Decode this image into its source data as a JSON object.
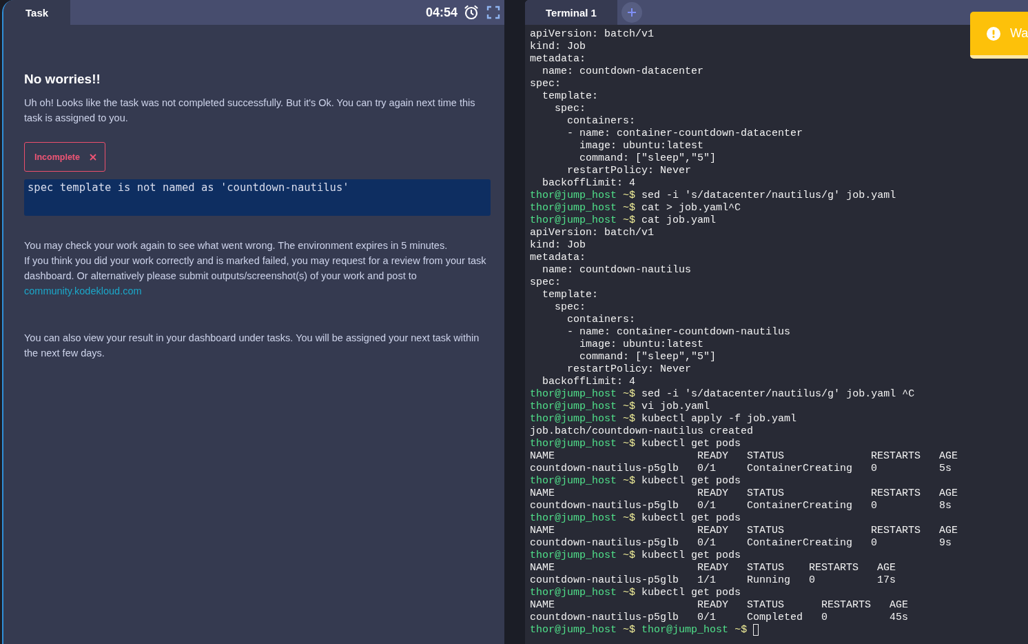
{
  "task_panel": {
    "tab": {
      "label": "Task",
      "selected": true
    },
    "timer": "04:54",
    "heading": "No worries!!",
    "intro": "Uh oh! Looks like the task was not completed successfully. But it's Ok. You can try again next time this task is assigned to you.",
    "status_badge": "Incomplete",
    "error_message": "spec template is not named as 'countdown-nautilus'",
    "notice": {
      "lines": [
        "You may check your work again to see what went wrong. The environment expires in 5 minutes.",
        "If you think you did your work correctly and is marked failed, you may request for a review from your task dashboard. Or alternatively please submit outputs/screenshot(s) of your work and post to"
      ],
      "link": "community.kodekloud.com"
    },
    "footer": "You can also view your result in your dashboard under tasks. You will be assigned your next task within the next few days."
  },
  "terminal_panel": {
    "tabs": [
      {
        "label": "Terminal 1",
        "selected": true
      }
    ],
    "toast": {
      "text": "Wa"
    },
    "lines": [
      {
        "kind": "output",
        "text": "apiVersion: batch/v1"
      },
      {
        "kind": "output",
        "text": "kind: Job"
      },
      {
        "kind": "output",
        "text": "metadata:"
      },
      {
        "kind": "output",
        "text": "  name: countdown-datacenter"
      },
      {
        "kind": "output",
        "text": "spec:"
      },
      {
        "kind": "output",
        "text": "  template:"
      },
      {
        "kind": "output",
        "text": "    spec:"
      },
      {
        "kind": "output",
        "text": "      containers:"
      },
      {
        "kind": "output",
        "text": "      - name: container-countdown-datacenter"
      },
      {
        "kind": "output",
        "text": "        image: ubuntu:latest"
      },
      {
        "kind": "output",
        "text": "        command: [\"sleep\",\"5\"]"
      },
      {
        "kind": "output",
        "text": "      restartPolicy: Never"
      },
      {
        "kind": "output",
        "text": "  backoffLimit: 4"
      },
      {
        "kind": "prompt",
        "prompts": [
          {
            "user": "thor@jump_host",
            "path": "~$"
          }
        ],
        "command": "sed -i 's/datacenter/nautilus/g' job.yaml"
      },
      {
        "kind": "prompt",
        "prompts": [
          {
            "user": "thor@jump_host",
            "path": "~$"
          }
        ],
        "command": "cat > job.yaml^C"
      },
      {
        "kind": "prompt",
        "prompts": [
          {
            "user": "thor@jump_host",
            "path": "~$"
          }
        ],
        "command": "cat job.yaml"
      },
      {
        "kind": "output",
        "text": "apiVersion: batch/v1"
      },
      {
        "kind": "output",
        "text": "kind: Job"
      },
      {
        "kind": "output",
        "text": "metadata:"
      },
      {
        "kind": "output",
        "text": "  name: countdown-nautilus"
      },
      {
        "kind": "output",
        "text": "spec:"
      },
      {
        "kind": "output",
        "text": "  template:"
      },
      {
        "kind": "output",
        "text": "    spec:"
      },
      {
        "kind": "output",
        "text": "      containers:"
      },
      {
        "kind": "output",
        "text": "      - name: container-countdown-nautilus"
      },
      {
        "kind": "output",
        "text": "        image: ubuntu:latest"
      },
      {
        "kind": "output",
        "text": "        command: [\"sleep\",\"5\"]"
      },
      {
        "kind": "output",
        "text": "      restartPolicy: Never"
      },
      {
        "kind": "output",
        "text": "  backoffLimit: 4"
      },
      {
        "kind": "prompt",
        "prompts": [
          {
            "user": "thor@jump_host",
            "path": "~$"
          }
        ],
        "command": "sed -i 's/datacenter/nautilus/g' job.yaml ^C"
      },
      {
        "kind": "prompt",
        "prompts": [
          {
            "user": "thor@jump_host",
            "path": "~$"
          }
        ],
        "command": "vi job.yaml"
      },
      {
        "kind": "prompt",
        "prompts": [
          {
            "user": "thor@jump_host",
            "path": "~$"
          }
        ],
        "command": "kubectl apply -f job.yaml"
      },
      {
        "kind": "output",
        "text": "job.batch/countdown-nautilus created"
      },
      {
        "kind": "prompt",
        "prompts": [
          {
            "user": "thor@jump_host",
            "path": "~$"
          }
        ],
        "command": "kubectl get pods"
      },
      {
        "kind": "output",
        "text": "NAME                       READY   STATUS              RESTARTS   AGE"
      },
      {
        "kind": "output",
        "text": "countdown-nautilus-p5glb   0/1     ContainerCreating   0          5s"
      },
      {
        "kind": "prompt",
        "prompts": [
          {
            "user": "thor@jump_host",
            "path": "~$"
          }
        ],
        "command": "kubectl get pods"
      },
      {
        "kind": "output",
        "text": "NAME                       READY   STATUS              RESTARTS   AGE"
      },
      {
        "kind": "output",
        "text": "countdown-nautilus-p5glb   0/1     ContainerCreating   0          8s"
      },
      {
        "kind": "prompt",
        "prompts": [
          {
            "user": "thor@jump_host",
            "path": "~$"
          }
        ],
        "command": "kubectl get pods"
      },
      {
        "kind": "output",
        "text": "NAME                       READY   STATUS              RESTARTS   AGE"
      },
      {
        "kind": "output",
        "text": "countdown-nautilus-p5glb   0/1     ContainerCreating   0          9s"
      },
      {
        "kind": "prompt",
        "prompts": [
          {
            "user": "thor@jump_host",
            "path": "~$"
          }
        ],
        "command": "kubectl get pods"
      },
      {
        "kind": "output",
        "text": "NAME                       READY   STATUS    RESTARTS   AGE"
      },
      {
        "kind": "output",
        "text": "countdown-nautilus-p5glb   1/1     Running   0          17s"
      },
      {
        "kind": "prompt",
        "prompts": [
          {
            "user": "thor@jump_host",
            "path": "~$"
          }
        ],
        "command": "kubectl get pods"
      },
      {
        "kind": "output",
        "text": "NAME                       READY   STATUS      RESTARTS   AGE"
      },
      {
        "kind": "output",
        "text": "countdown-nautilus-p5glb   0/1     Completed   0          45s"
      },
      {
        "kind": "prompt",
        "prompts": [
          {
            "user": "thor@jump_host",
            "path": "~$"
          },
          {
            "user": "thor@jump_host",
            "path": "~$"
          }
        ],
        "cursor": true
      }
    ]
  }
}
